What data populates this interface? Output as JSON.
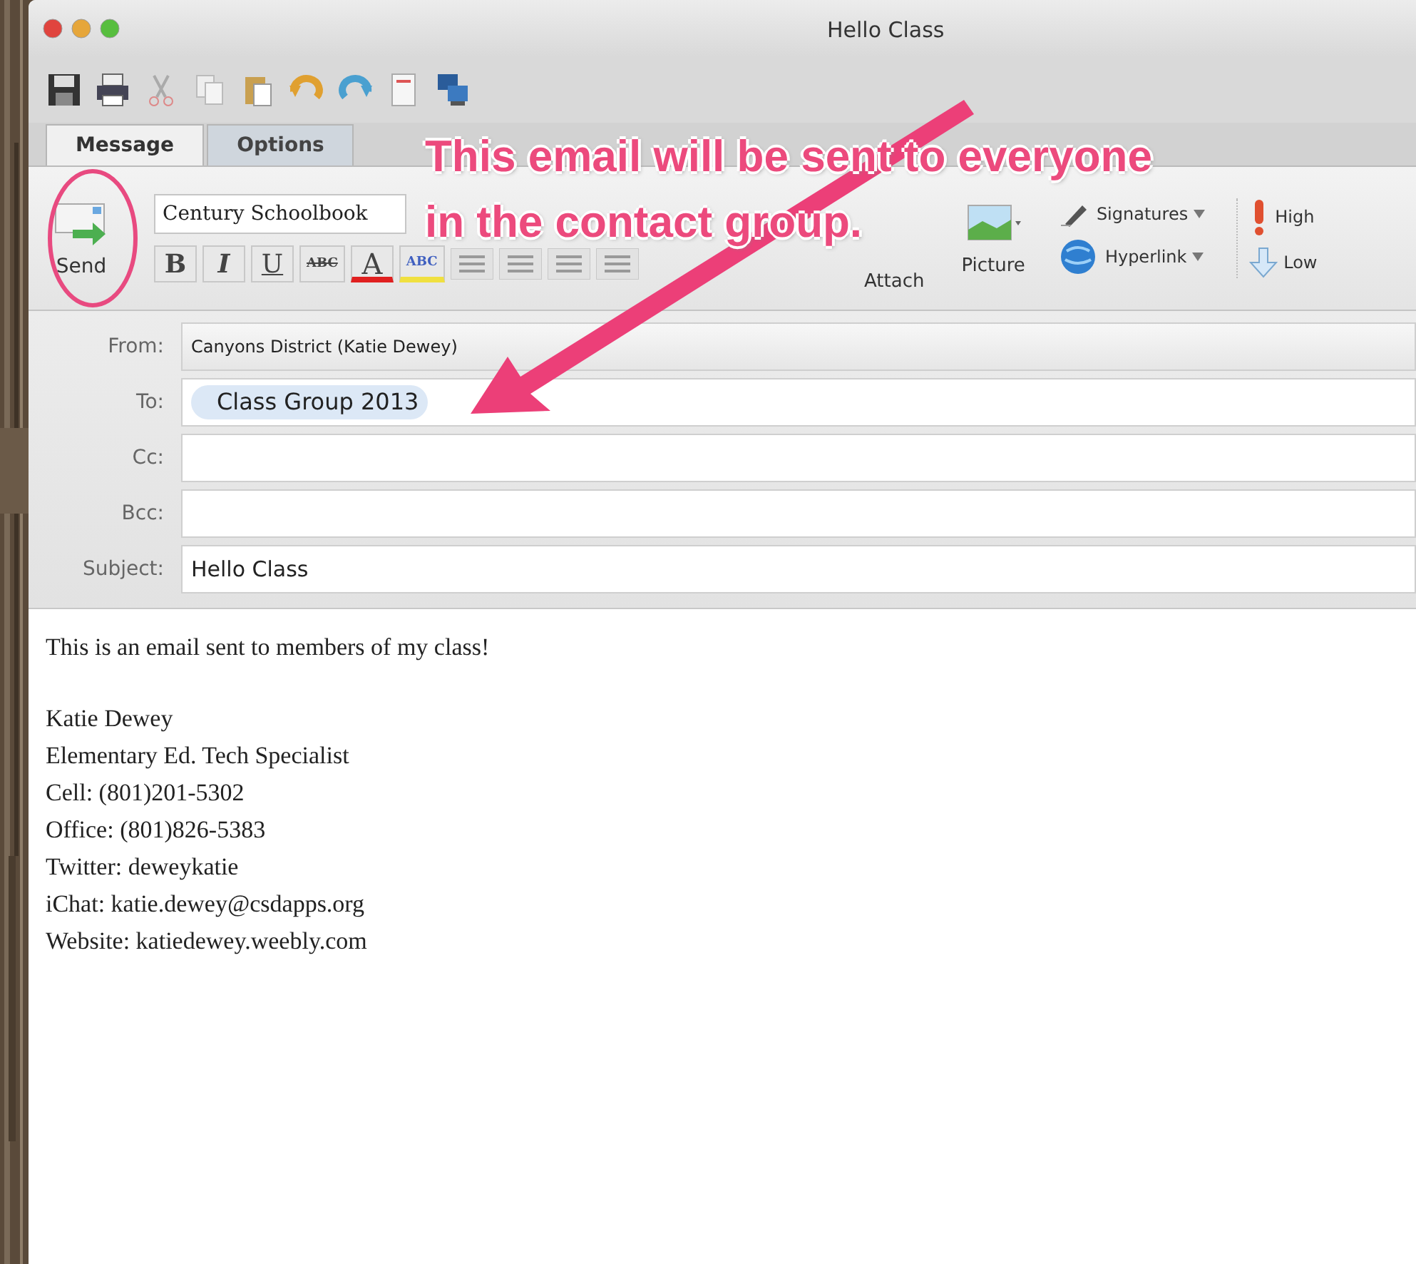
{
  "window": {
    "title": "Hello Class"
  },
  "tabs": [
    {
      "label": "Message",
      "selected": true
    },
    {
      "label": "Options",
      "selected": false
    }
  ],
  "ribbon": {
    "send_button": "Send",
    "font_name": "Century Schoolbook",
    "format_buttons": [
      {
        "kind": "bold",
        "label": "B"
      },
      {
        "kind": "italic",
        "label": "I"
      },
      {
        "kind": "underline",
        "label": "U"
      },
      {
        "kind": "strike",
        "label": "ABC"
      },
      {
        "kind": "font-color",
        "label": "A"
      },
      {
        "kind": "highlight",
        "label": "ABC"
      }
    ],
    "attach": "Attach",
    "picture": "Picture",
    "signatures": "Signatures",
    "hyperlink": "Hyperlink",
    "high": "High",
    "low": "Low"
  },
  "header_fields": [
    {
      "label": "From:",
      "kind": "dropdown",
      "value": "Canyons District (Katie Dewey)"
    },
    {
      "label": "To:",
      "kind": "recipients",
      "tokens": [
        "Class Group 2013"
      ]
    },
    {
      "label": "Cc:",
      "kind": "text"
    },
    {
      "label": "Bcc:",
      "kind": "text"
    },
    {
      "label": "Subject:",
      "kind": "text",
      "value": "Hello Class"
    }
  ],
  "body": {
    "paragraphs": [
      [
        "This is an email sent to members of my class!"
      ],
      [
        "Katie Dewey",
        "Elementary Ed. Tech Specialist",
        "Cell: (801)201-5302",
        "Office: (801)826-5383",
        "Twitter: deweykatie",
        "iChat:  katie.dewey@csdapps.org",
        "Website: katiedewey.weebly.com"
      ]
    ]
  },
  "annotation": {
    "lines": [
      "This email will be sent to everyone",
      "in the contact group."
    ]
  }
}
